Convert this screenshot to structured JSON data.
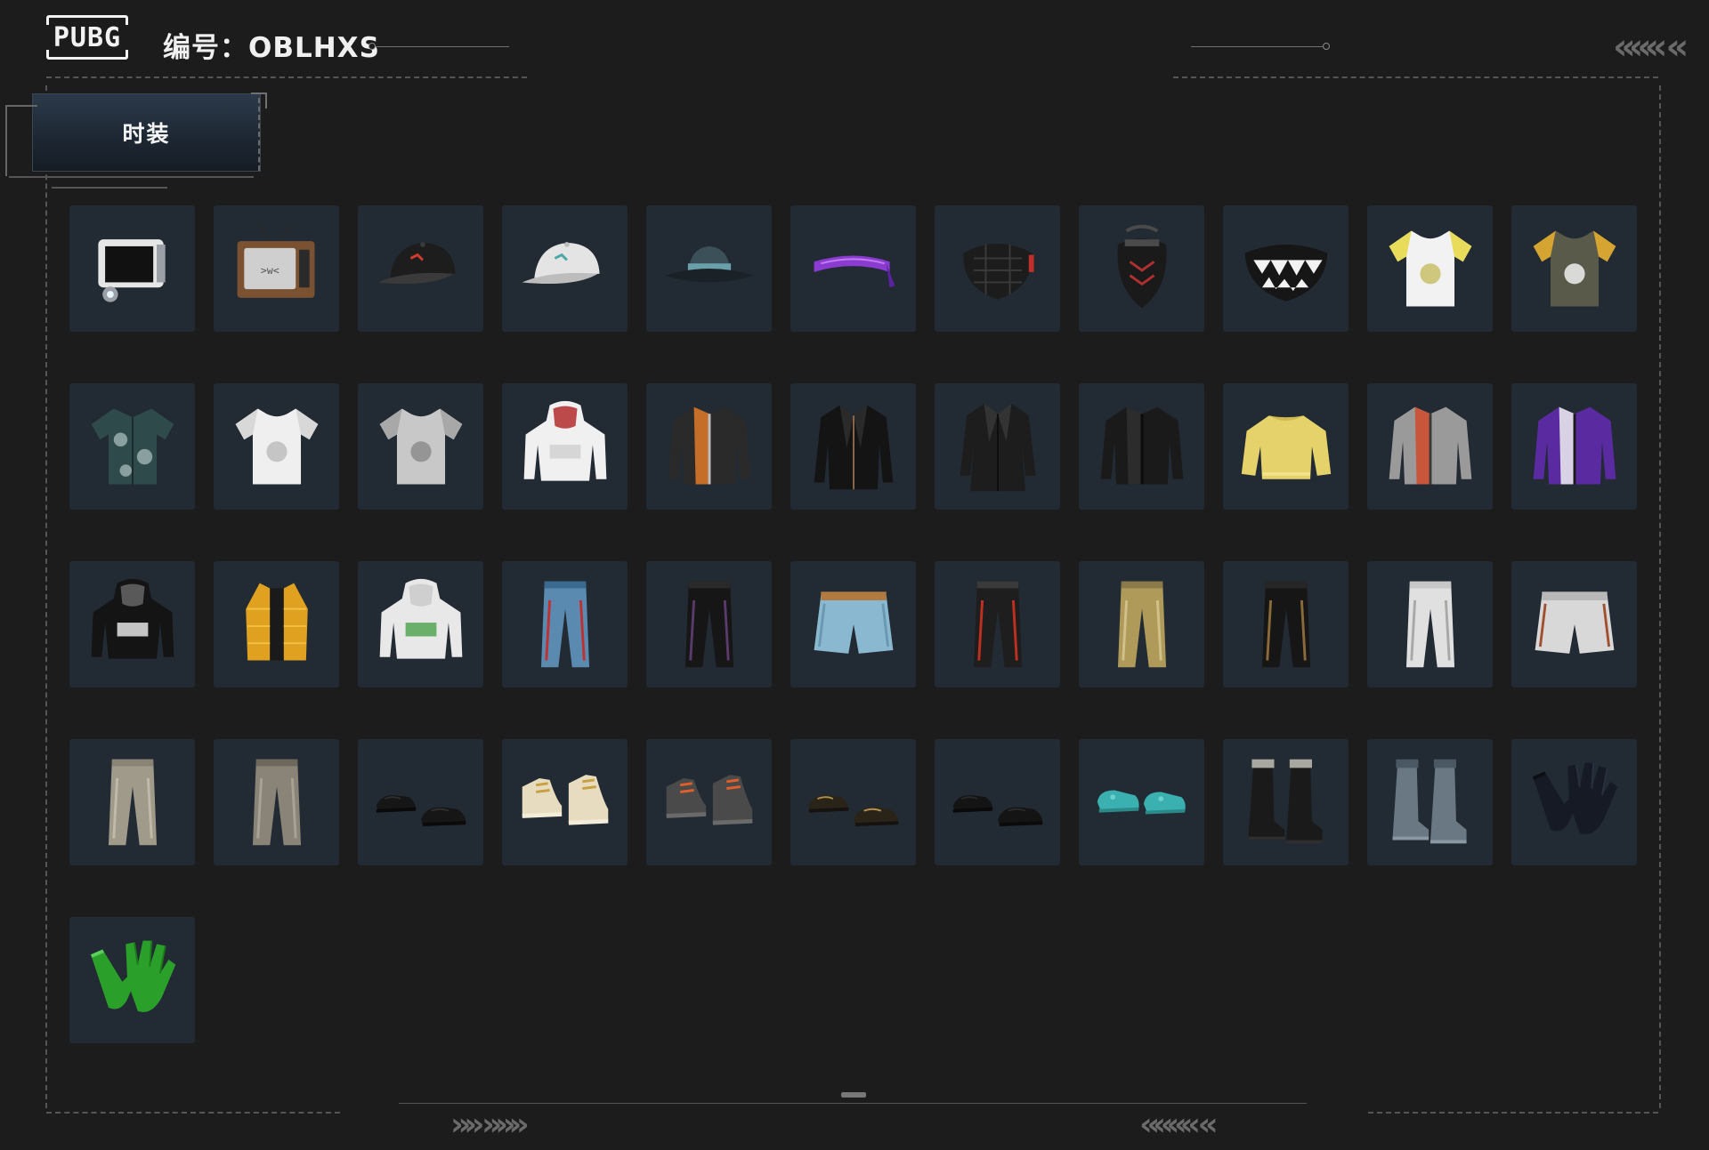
{
  "header": {
    "logo_text": "PUBG",
    "id_label": "编号：OBLHXS"
  },
  "category_tab": {
    "label": "时装"
  },
  "items": [
    {
      "icon": "camera-head-icon",
      "colors": [
        "#e6e6e6",
        "#9aa0a6",
        "#111111"
      ]
    },
    {
      "icon": "tv-head-icon",
      "colors": [
        "#7a5232",
        "#cfcfcf",
        "#2a2a2a"
      ]
    },
    {
      "icon": "baseball-cap-icon",
      "colors": [
        "#1d1d1d",
        "#3a3a3a",
        "#d33b2c"
      ]
    },
    {
      "icon": "baseball-cap-icon",
      "colors": [
        "#e4e4e4",
        "#bdbdbd",
        "#4aa8a8"
      ]
    },
    {
      "icon": "bucket-hat-icon",
      "colors": [
        "#3b5058",
        "#1a2228",
        "#6aa0aa"
      ]
    },
    {
      "icon": "headband-icon",
      "colors": [
        "#8a3bd0",
        "#5a22a0",
        "#c37cf0"
      ]
    },
    {
      "icon": "face-mask-icon",
      "colors": [
        "#1c1c1c",
        "#3a3a3a",
        "#c0302a"
      ]
    },
    {
      "icon": "respirator-mask-icon",
      "colors": [
        "#1a1a1a",
        "#b03030",
        "#4a4a4a"
      ]
    },
    {
      "icon": "teeth-mask-icon",
      "colors": [
        "#161616",
        "#f2f2f2",
        "#333333"
      ]
    },
    {
      "icon": "tshirt-icon",
      "colors": [
        "#f2f2f2",
        "#e8dc5a",
        "#c9c06a"
      ]
    },
    {
      "icon": "tshirt-icon",
      "colors": [
        "#5a5a4a",
        "#d6a531",
        "#f0f0f0"
      ]
    },
    {
      "icon": "shirt-icon",
      "colors": [
        "#2f4a4a",
        "#8aa0a0",
        "#1c2a2a"
      ]
    },
    {
      "icon": "tshirt-icon",
      "colors": [
        "#efefef",
        "#d8d8d8",
        "#bdbdbd"
      ]
    },
    {
      "icon": "tshirt-icon",
      "colors": [
        "#c8c8c8",
        "#a8a8a8",
        "#8c8c8c"
      ]
    },
    {
      "icon": "hoodie-icon",
      "colors": [
        "#f0f0f0",
        "#d0d0d0",
        "#b02020"
      ]
    },
    {
      "icon": "jacket-icon",
      "colors": [
        "#2a2a2a",
        "#e07a2a",
        "#bdbdbd"
      ]
    },
    {
      "icon": "coat-icon",
      "colors": [
        "#141414",
        "#2a2a2a",
        "#8a6a4a"
      ]
    },
    {
      "icon": "long-coat-icon",
      "colors": [
        "#1d1d1d",
        "#333333",
        "#0e0e0e"
      ]
    },
    {
      "icon": "jacket-icon",
      "colors": [
        "#1a1a1a",
        "#303030",
        "#0c0c0c"
      ]
    },
    {
      "icon": "sweater-icon",
      "colors": [
        "#e6d26a",
        "#cdb94e",
        "#f2e28a"
      ]
    },
    {
      "icon": "jacket-icon",
      "colors": [
        "#9a9a9a",
        "#d04a2a",
        "#3a3a3a"
      ]
    },
    {
      "icon": "jacket-icon",
      "colors": [
        "#5a2aa0",
        "#f0f0f0",
        "#1a1a1a"
      ]
    },
    {
      "icon": "hoodie-icon",
      "colors": [
        "#141414",
        "#f0f0f0",
        "#6a6a6a"
      ]
    },
    {
      "icon": "vest-icon",
      "colors": [
        "#e0a020",
        "#1a1a1a",
        "#f2c040"
      ]
    },
    {
      "icon": "hoodie-icon",
      "colors": [
        "#e8e8e8",
        "#4aa04a",
        "#c8c8c8"
      ]
    },
    {
      "icon": "pants-icon",
      "colors": [
        "#5a8ab0",
        "#3a6a90",
        "#c03030"
      ]
    },
    {
      "icon": "pants-icon",
      "colors": [
        "#161616",
        "#2a2a2a",
        "#5a3a6a"
      ]
    },
    {
      "icon": "shorts-icon",
      "colors": [
        "#8ab8d0",
        "#b07a40",
        "#6a98b0"
      ]
    },
    {
      "icon": "pants-icon",
      "colors": [
        "#1e1e1e",
        "#3a3a3a",
        "#c03020"
      ]
    },
    {
      "icon": "pants-icon",
      "colors": [
        "#b09a5a",
        "#8a7a4a",
        "#d0c08a"
      ]
    },
    {
      "icon": "pants-icon",
      "colors": [
        "#161616",
        "#262626",
        "#8a6a3a"
      ]
    },
    {
      "icon": "pants-icon",
      "colors": [
        "#e0e0e0",
        "#c8c8c8",
        "#a8a8a8"
      ]
    },
    {
      "icon": "shorts-icon",
      "colors": [
        "#d8d8d8",
        "#b8b8b8",
        "#a05030"
      ]
    },
    {
      "icon": "pants-icon",
      "colors": [
        "#a09a8a",
        "#8a8474",
        "#c0baa8"
      ]
    },
    {
      "icon": "pants-icon",
      "colors": [
        "#8a8478",
        "#6e685c",
        "#a8a294"
      ]
    },
    {
      "icon": "dress-shoes-icon",
      "colors": [
        "#161616",
        "#2e2e2e",
        "#0a0a0a"
      ]
    },
    {
      "icon": "sneakers-icon",
      "colors": [
        "#e8dcc0",
        "#c8a040",
        "#f2ecd8"
      ]
    },
    {
      "icon": "sneakers-icon",
      "colors": [
        "#4a4a4a",
        "#e0602a",
        "#6a6a6a"
      ]
    },
    {
      "icon": "dress-shoes-icon",
      "colors": [
        "#2a2418",
        "#b09050",
        "#161210"
      ]
    },
    {
      "icon": "dress-shoes-icon",
      "colors": [
        "#141414",
        "#2a2a2a",
        "#0a0a0a"
      ]
    },
    {
      "icon": "clogs-icon",
      "colors": [
        "#3ab0b0",
        "#2a8a8a",
        "#6ad0d0"
      ]
    },
    {
      "icon": "boots-icon",
      "colors": [
        "#1a1a1a",
        "#a8a8a0",
        "#2e2e2e"
      ]
    },
    {
      "icon": "boots-icon",
      "colors": [
        "#6a7884",
        "#4a5864",
        "#8a98a4"
      ]
    },
    {
      "icon": "gloves-icon",
      "colors": [
        "#161a24",
        "#2a3040",
        "#0c0e14"
      ]
    },
    {
      "icon": "gloves-icon",
      "colors": [
        "#2aa02a",
        "#1a7a1a",
        "#5ad05a"
      ]
    }
  ]
}
